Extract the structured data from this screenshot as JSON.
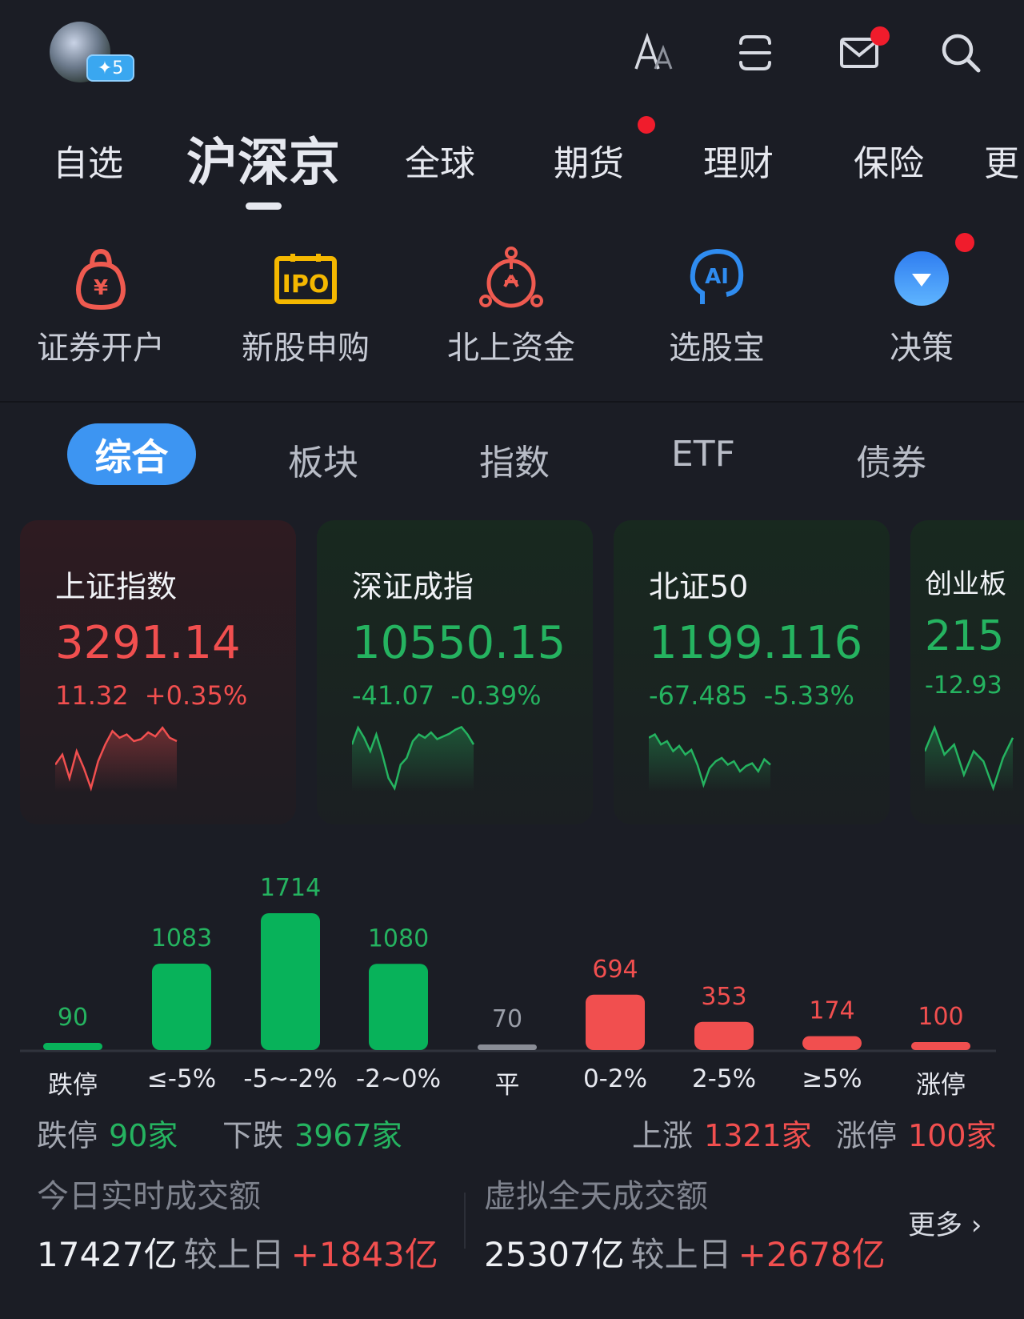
{
  "header": {
    "badge": "✦5",
    "icons": [
      "font-size-icon",
      "menu-icon",
      "mail-icon",
      "search-icon"
    ]
  },
  "tabs": [
    {
      "label": "自选"
    },
    {
      "label": "沪深京",
      "active": true
    },
    {
      "label": "全球"
    },
    {
      "label": "期货",
      "dot": true
    },
    {
      "label": "理财"
    },
    {
      "label": "保险"
    },
    {
      "label": "更"
    }
  ],
  "shortcuts": [
    {
      "label": "证券开户",
      "icon": "money-bag-icon"
    },
    {
      "label": "新股申购",
      "icon": "ipo-icon",
      "icon_text": "IPO"
    },
    {
      "label": "北上资金",
      "icon": "hk-flower-icon"
    },
    {
      "label": "选股宝",
      "icon": "ai-head-icon",
      "icon_text": "AI"
    },
    {
      "label": "决策",
      "icon": "dropdown-circle-icon"
    }
  ],
  "subtabs": [
    {
      "label": "综合",
      "active": true
    },
    {
      "label": "板块"
    },
    {
      "label": "指数"
    },
    {
      "label": "ETF"
    },
    {
      "label": "债券"
    }
  ],
  "colors": {
    "up": "#f14f4f",
    "down": "#25b360",
    "flat": "#9a9ea8",
    "accent": "#3d95f2"
  },
  "indices": [
    {
      "name": "上证指数",
      "value": "3291.14",
      "change": "11.32",
      "pct": "+0.35%",
      "trend": "up",
      "spark": [
        40,
        55,
        20,
        60,
        35,
        5,
        45,
        70,
        90,
        80,
        85,
        75,
        78,
        88,
        82,
        95,
        80,
        75
      ]
    },
    {
      "name": "深证成指",
      "value": "10550.15",
      "change": "-41.07",
      "pct": "-0.39%",
      "trend": "down",
      "spark": [
        70,
        95,
        80,
        60,
        85,
        55,
        20,
        5,
        40,
        50,
        75,
        85,
        80,
        88,
        78,
        82,
        86,
        92,
        96,
        85,
        70
      ]
    },
    {
      "name": "北证50",
      "value": "1199.116",
      "change": "-67.485",
      "pct": "-5.33%",
      "trend": "down",
      "spark": [
        80,
        85,
        70,
        75,
        60,
        68,
        55,
        62,
        40,
        10,
        35,
        45,
        50,
        40,
        45,
        30,
        38,
        42,
        30,
        48,
        40
      ]
    },
    {
      "name": "创业板",
      "value": "215",
      "change": "-12.93",
      "pct": "",
      "trend": "down",
      "spark": [
        60,
        95,
        55,
        70,
        25,
        60,
        45,
        5,
        50,
        80
      ]
    }
  ],
  "chart_data": {
    "type": "bar",
    "categories": [
      "跌停",
      "≤-5%",
      "-5~-2%",
      "-2~0%",
      "平",
      "0-2%",
      "2-5%",
      "≥5%",
      "涨停"
    ],
    "values": [
      90,
      1083,
      1714,
      1080,
      70,
      694,
      353,
      174,
      100
    ],
    "trend": [
      "down",
      "down",
      "down",
      "down",
      "flat",
      "up",
      "up",
      "up",
      "up"
    ]
  },
  "summary": {
    "limit_down_label": "跌停",
    "limit_down": "90家",
    "down_label": "下跌",
    "down": "3967家",
    "up_label": "上涨",
    "up": "1321家",
    "limit_up_label": "涨停",
    "limit_up": "100家"
  },
  "turnover": {
    "today_label": "今日实时成交额",
    "today": "17427亿",
    "compare_label": "较上日",
    "today_delta": "+1843亿",
    "virtual_label": "虚拟全天成交额",
    "virtual": "25307亿",
    "virtual_delta": "+2678亿",
    "more": "更多 ›"
  }
}
